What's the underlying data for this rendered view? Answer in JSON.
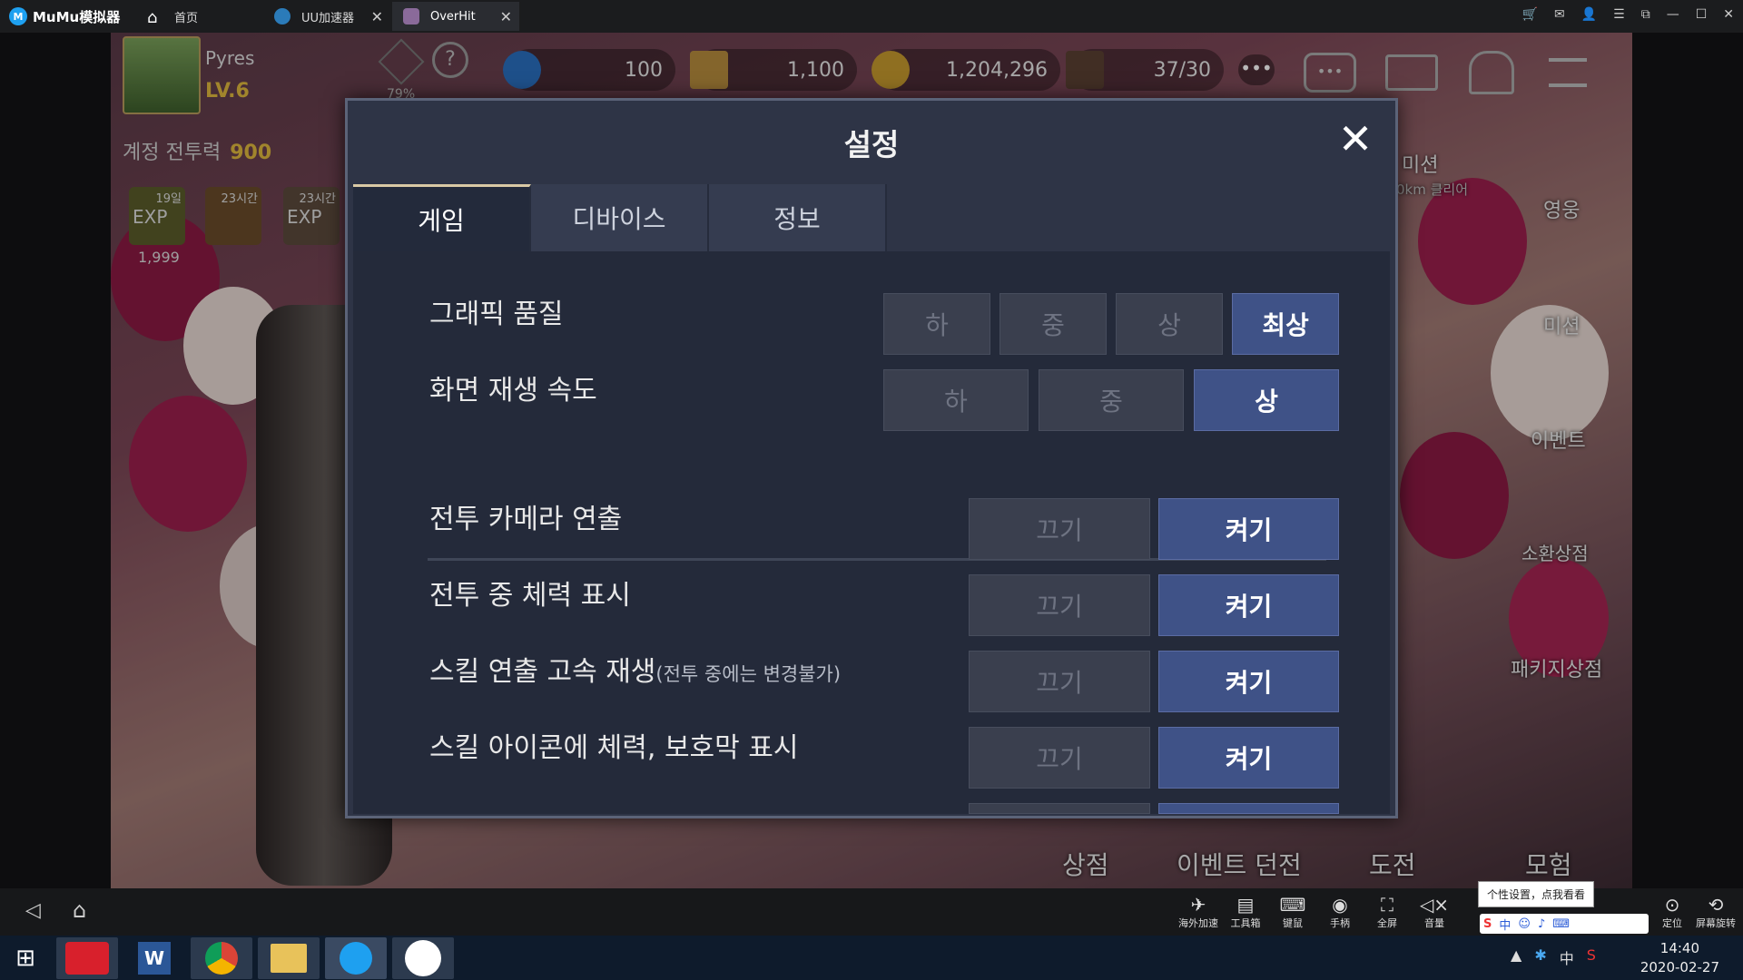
{
  "window": {
    "app_name": "MuMu模拟器",
    "tabs": [
      {
        "label": "首页"
      },
      {
        "label": "UU加速器"
      },
      {
        "label": "OverHit"
      }
    ]
  },
  "hud": {
    "player_name": "Pyres",
    "level": "LV.6",
    "percent": "79%",
    "power_label": "계정 전투력",
    "power_value": "900",
    "buff_1_time": "19일",
    "buff_2_time": "23시간",
    "buff_3_time": "23시간",
    "buff_exp": "EXP",
    "buff_value": "1,999",
    "gems": "100",
    "cubes": "1,100",
    "gold": "1,204,296",
    "stamina": "37/30"
  },
  "right_menu": {
    "mission_title": "미션",
    "mission_sub": "0km 클리어",
    "hero": "영웅",
    "mission": "미션",
    "event": "이벤트",
    "summon": "소환상점",
    "package": "패키지상점"
  },
  "bottom_menu": {
    "shop": "상점",
    "event_dungeon": "이벤트 던전",
    "challenge": "도전",
    "adventure": "모험"
  },
  "settings": {
    "title": "설정",
    "close_icon": "close-icon",
    "tabs": [
      "게임",
      "디바이스",
      "정보"
    ],
    "graphics_label": "그래픽 품질",
    "graphics_options": [
      "하",
      "중",
      "상",
      "최상"
    ],
    "framerate_label": "화면 재생 속도",
    "framerate_options": [
      "하",
      "중",
      "상"
    ],
    "off": "끄기",
    "on": "켜기",
    "rows": [
      {
        "label": "전투 카메라 연출",
        "note": ""
      },
      {
        "label": "전투 중 체력 표시",
        "note": ""
      },
      {
        "label": "스킬 연출 고속 재생",
        "note": "(전투 중에는 변경불가)"
      },
      {
        "label": "스킬 아이콘에 체력, 보호막 표시",
        "note": ""
      }
    ],
    "colors": {
      "selected": "#3f5287",
      "panel": "#242a3a"
    }
  },
  "emulator_toolbar": {
    "items": [
      "海外加速",
      "工具箱",
      "键鼠",
      "手柄",
      "全屏",
      "音量",
      "定位",
      "屏幕旋转"
    ],
    "tooltip": "个性设置，点我看看"
  },
  "taskbar": {
    "time": "14:40",
    "date": "2020-02-27",
    "ime": "中"
  }
}
